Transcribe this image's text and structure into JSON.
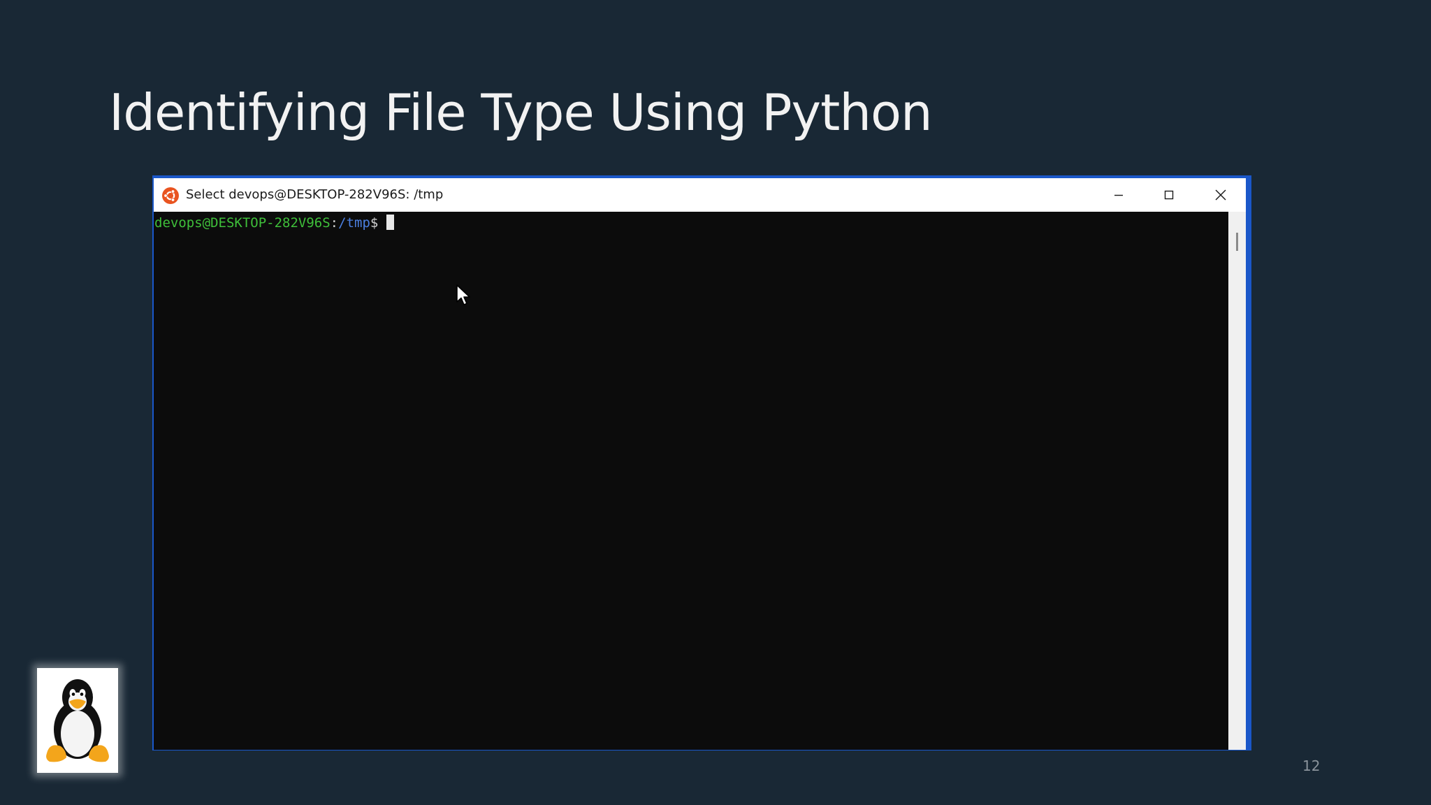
{
  "slide": {
    "title": "Identifying File Type Using Python",
    "slide_number": "12"
  },
  "terminal": {
    "window_title": "Select devops@DESKTOP-282V96S: /tmp",
    "prompt": {
      "user_host": "devops@DESKTOP-282V96S",
      "separator": ":",
      "path": "/tmp",
      "symbol": "$"
    },
    "buttons": {
      "minimize": "minimize-icon",
      "maximize": "maximize-icon",
      "close": "close-icon"
    },
    "colors": {
      "user_host": "#3fbf3a",
      "path": "#4b7fe0",
      "background": "#0c0c0c",
      "frame_accent": "#1a57c9"
    }
  },
  "icons": {
    "app": "ubuntu-icon",
    "logo": "tux-penguin-icon",
    "pointer": "mouse-pointer-icon"
  }
}
